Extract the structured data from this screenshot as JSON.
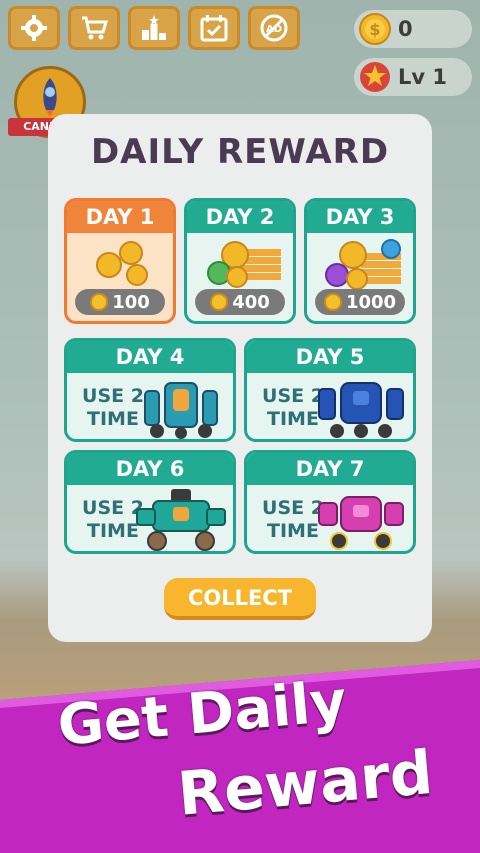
{
  "header": {
    "coins": "0",
    "level": "Lv 1",
    "avatar_label": "CANNON"
  },
  "panel": {
    "title": "DAILY REWARD",
    "days": [
      {
        "label": "DAY 1",
        "amount": "100"
      },
      {
        "label": "DAY 2",
        "amount": "400"
      },
      {
        "label": "DAY 3",
        "amount": "1000"
      },
      {
        "label": "DAY 4",
        "use": "USE 2 TIME"
      },
      {
        "label": "DAY 5",
        "use": "USE 2 TIME"
      },
      {
        "label": "DAY 6",
        "use": "USE 2 TIME"
      },
      {
        "label": "DAY 7",
        "use": "USE 2 TIME"
      }
    ],
    "collect_label": "COLLECT"
  },
  "banner": {
    "line1": "Get Daily",
    "line2": "Reward"
  },
  "colors": {
    "card_teal": "#21ab93",
    "card_active": "#f0843a",
    "collect_button": "#f7b62d",
    "banner_magenta": "#c126c0"
  }
}
